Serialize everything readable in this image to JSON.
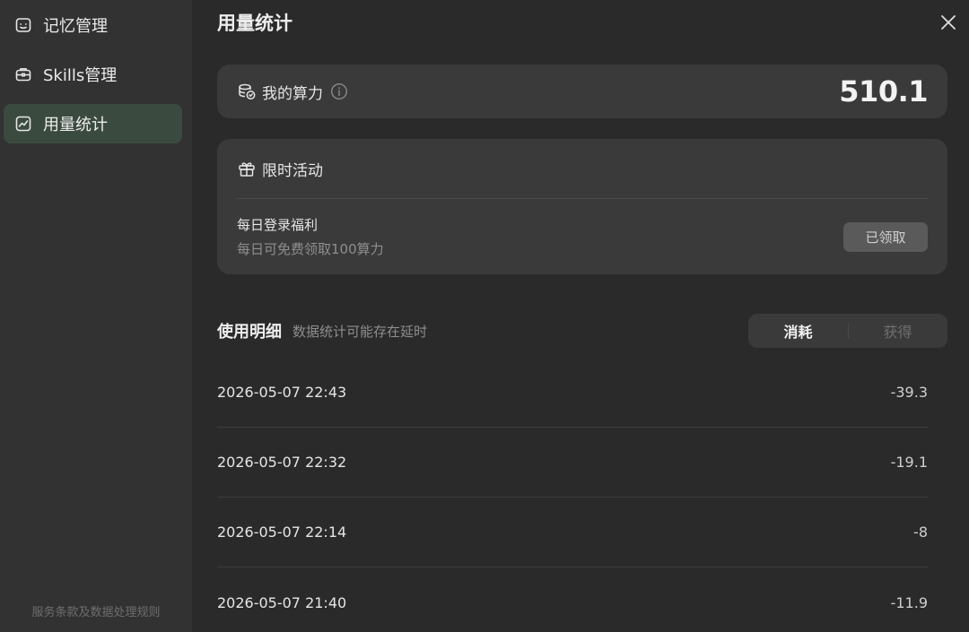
{
  "sidebar": {
    "items": [
      {
        "label": "记忆管理",
        "icon": "memory-icon",
        "active": false
      },
      {
        "label": "Skills管理",
        "icon": "toolbox-icon",
        "active": false
      },
      {
        "label": "用量统计",
        "icon": "chart-icon",
        "active": true
      }
    ],
    "footer_link": "服务条款及数据处理规则"
  },
  "page": {
    "title": "用量统计"
  },
  "power": {
    "title": "我的算力",
    "value": "510.1"
  },
  "promo": {
    "title": "限时活动",
    "item_title": "每日登录福利",
    "item_desc": "每日可免费领取100算力",
    "button_label": "已领取"
  },
  "details": {
    "title": "使用明细",
    "note": "数据统计可能存在延时",
    "tabs": [
      {
        "label": "消耗",
        "active": true
      },
      {
        "label": "获得",
        "active": false
      }
    ],
    "rows": [
      {
        "time": "2026-05-07 22:43",
        "amount": "-39.3"
      },
      {
        "time": "2026-05-07 22:32",
        "amount": "-19.1"
      },
      {
        "time": "2026-05-07 22:14",
        "amount": "-8"
      },
      {
        "time": "2026-05-07 21:40",
        "amount": "-11.9"
      }
    ]
  },
  "colors": {
    "sidebar_bg": "#323232",
    "main_bg": "#2a2a2a",
    "card_bg": "#3a3a3a",
    "active_nav_bg": "#3b4a3f"
  }
}
